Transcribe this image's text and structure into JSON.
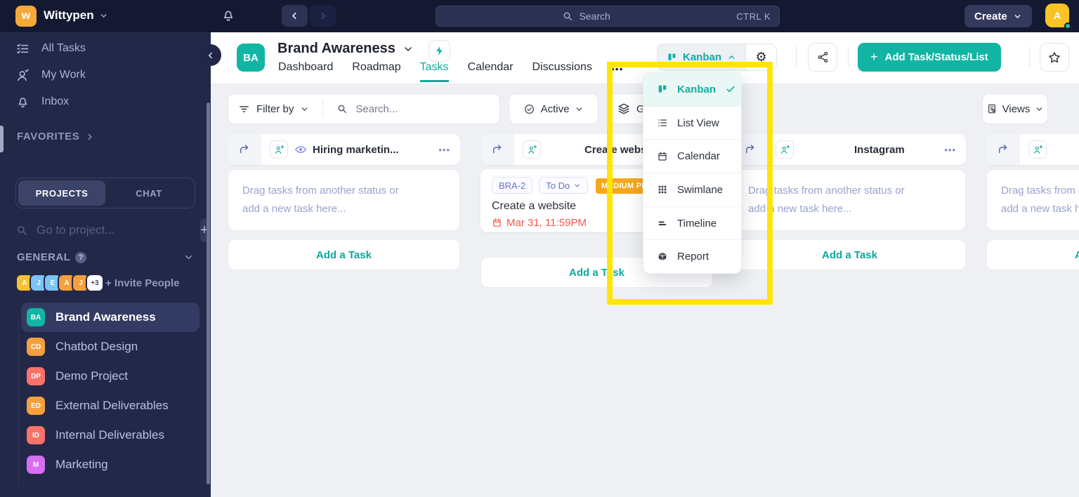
{
  "topbar": {
    "workspace_initial": "w",
    "workspace_name": "Wittypen",
    "search_placeholder": "Search",
    "search_shortcut": "CTRL K",
    "create_label": "Create",
    "avatar_initial": "A"
  },
  "sidebar": {
    "nav": [
      {
        "label": "All Tasks"
      },
      {
        "label": "My Work"
      },
      {
        "label": "Inbox"
      }
    ],
    "favorites_label": "FAVORITES",
    "tabs": {
      "projects": "PROJECTS",
      "chat": "CHAT"
    },
    "project_search_placeholder": "Go to project...",
    "general_label": "GENERAL",
    "invite_label": "+ Invite People",
    "member_avatars": [
      {
        "initial": "A",
        "color": "#f7c231",
        "text_color": "#ffffff"
      },
      {
        "initial": "J",
        "color": "#7cc4f5",
        "text_color": "#ffffff"
      },
      {
        "initial": "E",
        "color": "#7cc4f5",
        "text_color": "#ffffff"
      },
      {
        "initial": "A",
        "color": "#f59f3d",
        "text_color": "#ffffff"
      },
      {
        "initial": "J",
        "color": "#f59f3d",
        "text_color": "#ffffff"
      },
      {
        "initial": "+3",
        "color": "#ffffff",
        "text_color": "#434a6b"
      }
    ],
    "projects": [
      {
        "code": "BA",
        "name": "Brand Awareness",
        "color": "#12b5a4"
      },
      {
        "code": "CD",
        "name": "Chatbot Design",
        "color": "#f5a03e"
      },
      {
        "code": "DP",
        "name": "Demo Project",
        "color": "#fa7268"
      },
      {
        "code": "ED",
        "name": "External Deliverables",
        "color": "#f5a03e"
      },
      {
        "code": "ID",
        "name": "Internal Deliverables",
        "color": "#fa7268"
      },
      {
        "code": "M",
        "name": "Marketing",
        "color": "#d76df2"
      }
    ]
  },
  "header": {
    "project_initials": "BA",
    "title": "Brand Awareness",
    "tabs": [
      {
        "label": "Dashboard"
      },
      {
        "label": "Roadmap"
      },
      {
        "label": "Tasks"
      },
      {
        "label": "Calendar"
      },
      {
        "label": "Discussions"
      }
    ],
    "active_tab": "Tasks",
    "more_label": "•••",
    "view_switcher_label": "Kanban",
    "add_button_label": "Add Task/Status/List"
  },
  "filter_bar": {
    "filter_by_label": "Filter by",
    "search_placeholder": "Search...",
    "status_label": "Active",
    "group_by_partial": "G",
    "views_label": "Views"
  },
  "view_menu": {
    "selected": "Kanban",
    "items": [
      {
        "label": "Kanban"
      },
      {
        "label": "List View"
      },
      {
        "label": "Calendar"
      },
      {
        "label": "Swimlane"
      },
      {
        "label": "Timeline"
      },
      {
        "label": "Report"
      }
    ]
  },
  "board": {
    "columns": [
      {
        "title": "Hiring marketin...",
        "menu": "•••",
        "drag_line1": "Drag tasks from another status or",
        "drag_line2": "add a new task here...",
        "add_task_label": "Add a Task"
      },
      {
        "title": "Create website",
        "menu": "•••",
        "add_task_label": "Add a Task",
        "card": {
          "id": "BRA-2",
          "status": "To Do",
          "priority": "MEDIUM PRIORITY",
          "title": "Create a website",
          "due_date": "Mar 31, 11:59PM"
        }
      },
      {
        "title": "Instagram",
        "menu": "•••",
        "drag_line1": "Drag tasks from another status or",
        "drag_line2": "add a new task here...",
        "add_task_label": "Add a Task"
      },
      {
        "title": "",
        "drag_line1": "Drag tasks from another status or",
        "drag_line2": "add a new task here...",
        "add_task_label": "Add a Task"
      }
    ]
  },
  "colors": {
    "accent_teal": "#12b5a4",
    "highlight_yellow": "#ffe500",
    "priority_badge": "#f6a81c",
    "due_date_red": "#f2574b",
    "topbar_bg": "#141931",
    "sidebar_bg": "#232849"
  }
}
